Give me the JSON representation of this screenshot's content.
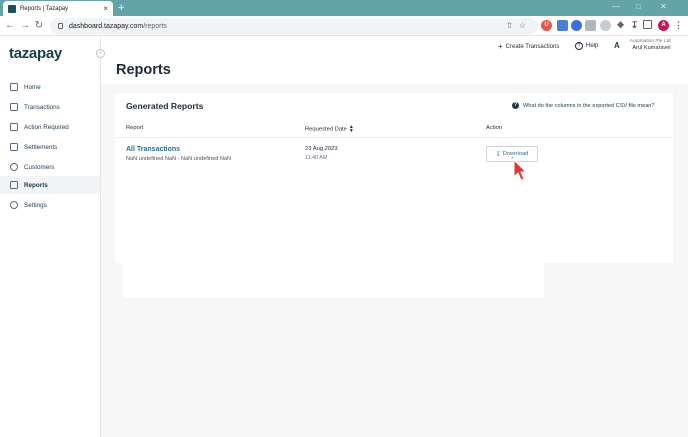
{
  "browser": {
    "tab_title": "Reports | Tazapay",
    "tab_close": "×",
    "new_tab": "+",
    "url_host": "dashboard.tazapay.com",
    "url_path": "/reports",
    "profile_initial": "A"
  },
  "sidebar": {
    "logo": "tazapay",
    "items": [
      {
        "label": "Home"
      },
      {
        "label": "Transactions"
      },
      {
        "label": "Action Required"
      },
      {
        "label": "Settlements"
      },
      {
        "label": "Customers"
      },
      {
        "label": "Reports"
      },
      {
        "label": "Settings"
      }
    ]
  },
  "header": {
    "create_label": "Create Transactions",
    "help_label": "Help",
    "avatar_initial": "A",
    "org_name": "Automation Pte Ltd",
    "user_name": "Arul Kumaravel"
  },
  "page": {
    "title": "Reports"
  },
  "reports": {
    "card_title": "Generated Reports",
    "csv_help": "What do the columns in the exported CSV file mean?",
    "columns": [
      "Report",
      "Requested Date",
      "Action"
    ],
    "rows": [
      {
        "name": "All Transactions",
        "range": "NaN undefined NaN - NaN undefined NaN",
        "date": "23 Aug 2023",
        "time": "11:40 AM",
        "action": "Download"
      }
    ]
  },
  "colors": {
    "brand": "#16404d",
    "link": "#2a6f8f",
    "chrome_tabbar": "#63a4a8",
    "cursor": "#e2363c"
  }
}
